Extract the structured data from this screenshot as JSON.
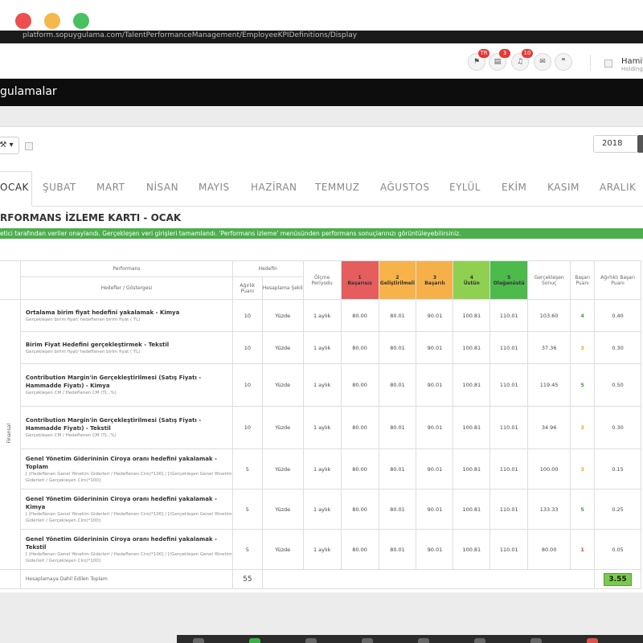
{
  "browser": {
    "url": "platform.sopuygulama.com/TalentPerformanceManagement/EmployeeKPIDefinitions/Display"
  },
  "topbar": {
    "lang_badge": "TR",
    "mail_badge": "3",
    "bell_badge": "10",
    "user_name": "Hamit",
    "user_sub": "Holding"
  },
  "darkbar": {
    "title": "gulamalar"
  },
  "toolbar": {
    "tool_label": "⚒ ▾",
    "year": "2018"
  },
  "tabs": [
    "OCAK",
    "ŞUBAT",
    "MART",
    "NİSAN",
    "MAYIS",
    "HAZİRAN",
    "TEMMUZ",
    "AĞUSTOS",
    "EYLÜL",
    "EKİM",
    "KASIM",
    "ARALIK"
  ],
  "card": {
    "title": "RFORMANS İZLEME KARTI - OCAK",
    "notice": "etici tarafından veriler onaylandı. Gerçekleşen veri girişleri tamamlandı. 'Performans izleme' menüsünden performans sonuçlarınızı görüntüleyebilirsiniz."
  },
  "table": {
    "headers": {
      "performans": "Performans",
      "hedefler": "Hedefler / Göstergesi",
      "hedefin": "Hedefin",
      "agirlik_puani": "Ağırlık Puanı",
      "hesaplama_sekli": "Hesaplama Şekli",
      "olcme_periyodu": "Ölçme Periyodu",
      "gerceklesen_sonuc": "Gerçekleşen Sonuç",
      "basari_puani": "Başarı Puanı",
      "agirlikli_basari_puani": "Ağırlıklı Başarı Puanı"
    },
    "levels": [
      {
        "num": "1",
        "label": "Başarısız"
      },
      {
        "num": "2",
        "label": "Geliştirilmeli"
      },
      {
        "num": "3",
        "label": "Başarılı"
      },
      {
        "num": "4",
        "label": "Üstün"
      },
      {
        "num": "5",
        "label": "Olağanüstü"
      }
    ],
    "group_label": "Finansal",
    "rows": [
      {
        "title": "Ortalama birim fiyat hedefini yakalamak - Kimya",
        "sub": "Gerçekleşen birim fiyat/ hedeflenen birim fiyat ( TL)",
        "weight": "10",
        "calc": "Yüzde",
        "period": "1 aylık",
        "l1": "80.00",
        "l2": "80.01",
        "l3": "90.01",
        "l4": "100.81",
        "l5": "110.01",
        "result": "103.60",
        "score": "4",
        "score_color": "g",
        "weighted": "0.40"
      },
      {
        "title": "Birim Fiyat Hedefini gerçekleştirmek - Tekstil",
        "sub": "Gerçekleşen birim fiyat/ hedeflenen birim fiyat ( TL)",
        "weight": "10",
        "calc": "Yüzde",
        "period": "1 aylık",
        "l1": "80.00",
        "l2": "80.01",
        "l3": "90.01",
        "l4": "100.81",
        "l5": "110.01",
        "result": "37.36",
        "score": "3",
        "score_color": "o",
        "weighted": "0.30"
      },
      {
        "title": "Contribution Margin'in Gerçekleştirilmesi (Satış Fiyatı - Hammadde Fiyatı) - Kimya",
        "sub": "Gerçekleşen CM / Hedeflenen CM (TL ,%)",
        "weight": "10",
        "calc": "Yüzde",
        "period": "1 aylık",
        "l1": "80.00",
        "l2": "80.01",
        "l3": "90.01",
        "l4": "100.81",
        "l5": "110.01",
        "result": "119.45",
        "score": "5",
        "score_color": "g",
        "weighted": "0.50"
      },
      {
        "title": "Contribution Margin'in Gerçekleştirilmesi (Satış Fiyatı - Hammadde Fiyatı) - Tekstil",
        "sub": "Gerçekleşen CM / Hedeflenen CM (TL ,%)",
        "weight": "10",
        "calc": "Yüzde",
        "period": "1 aylık",
        "l1": "80.00",
        "l2": "80.01",
        "l3": "90.01",
        "l4": "100.81",
        "l5": "110.01",
        "result": "34.96",
        "score": "3",
        "score_color": "o",
        "weighted": "0.30"
      },
      {
        "title": "Genel Yönetim Giderininin Ciroya oranı hedefini yakalamak - Toplam",
        "sub": "[ (Hedeflenen Genel Yönetim Giderleri / Hedeflenen Ciro)*100] / [(Gerçekleşen Genel Yönetim Giderleri / Gerçekleşen Ciro)*100]",
        "weight": "5",
        "calc": "Yüzde",
        "period": "1 aylık",
        "l1": "80.00",
        "l2": "80.01",
        "l3": "90.01",
        "l4": "100.81",
        "l5": "110.01",
        "result": "100.00",
        "score": "3",
        "score_color": "o",
        "weighted": "0.15"
      },
      {
        "title": "Genel Yönetim Giderininin Ciroya oranı hedefini yakalamak - Kimya",
        "sub": "[ (Hedeflenen Genel Yönetim Giderleri / Hedeflenen Ciro)*100] / [(Gerçekleşen Genel Yönetim Giderleri / Gerçekleşen Ciro)*100]",
        "weight": "5",
        "calc": "Yüzde",
        "period": "1 aylık",
        "l1": "80.00",
        "l2": "80.01",
        "l3": "90.01",
        "l4": "100.81",
        "l5": "110.01",
        "result": "133.33",
        "score": "5",
        "score_color": "g",
        "weighted": "0.25"
      },
      {
        "title": "Genel Yönetim Giderininin Ciroya oranı hedefini yakalamak - Tekstil",
        "sub": "[ (Hedeflenen Genel Yönetim Giderleri / Hedeflenen Ciro)*100] / [(Gerçekleşen Genel Yönetim Giderleri / Gerçekleşen Ciro)*100]",
        "weight": "5",
        "calc": "Yüzde",
        "period": "1 aylık",
        "l1": "80.00",
        "l2": "80.01",
        "l3": "90.01",
        "l4": "100.81",
        "l5": "110.01",
        "result": "80.00",
        "score": "1",
        "score_color": "r",
        "weighted": "0.05"
      }
    ],
    "total_label": "Hesaplamaya Dahil Edilen Toplam",
    "total_weight": "55",
    "total_score": "3.55"
  }
}
